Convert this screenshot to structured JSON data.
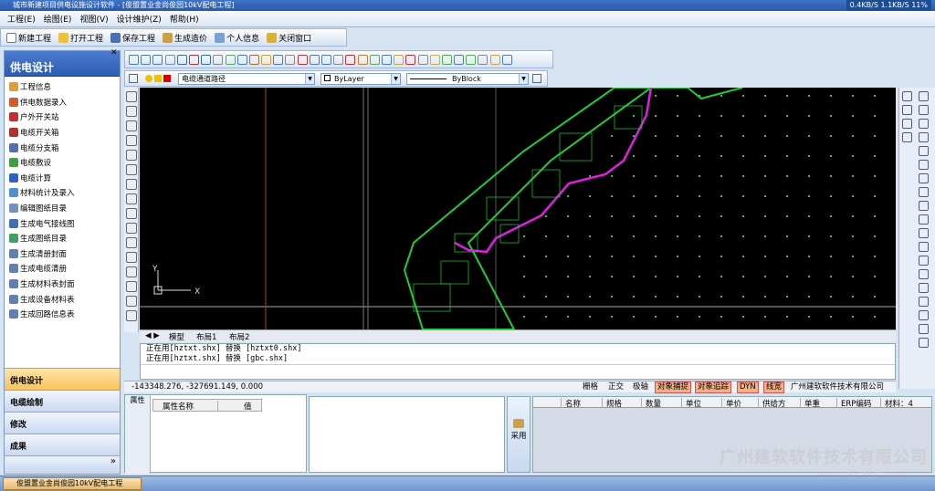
{
  "window": {
    "title": "城市新建项目供电设施设计软件 - [俊盟置业金尚俊园10kV配电工程]",
    "net_status": "0.4KB/S  1.1KB/S  11%"
  },
  "menu": [
    "工程(E)",
    "绘图(E)",
    "视图(V)",
    "设计维护(Z)",
    "帮助(H)"
  ],
  "toolbar": [
    "新建工程",
    "打开工程",
    "保存工程",
    "生成造价",
    "个人信息",
    "关闭窗口"
  ],
  "sidebar": {
    "title": "供电设计",
    "items": [
      "工程信息",
      "供电数据录入",
      "户外开关站",
      "电缆开关箱",
      "电缆分支箱",
      "电缆敷设",
      "电缆计算",
      "材料统计及录入",
      "编辑图纸目录",
      "生成电气接线图",
      "生成图纸目录",
      "生成清册封面",
      "生成电缆清册",
      "生成材料表封面",
      "生成设备材料表",
      "生成回路信息表"
    ],
    "nav": [
      "供电设计",
      "电缆绘制",
      "修改",
      "成果"
    ],
    "nav_active": "供电设计"
  },
  "layerbar": {
    "layer": "电缆通道路径",
    "color": "ByLayer",
    "linetype": "ByBlock"
  },
  "tabs": [
    "模型",
    "布局1",
    "布局2"
  ],
  "command": [
    "正在用[hztxt.shx] 替换 [hztxt0.shx]",
    "正在用[hztxt.shx] 替换 [gbc.shx]"
  ],
  "status": {
    "coords": "-143348.276,  -327691.149,  0.000",
    "toggles": [
      {
        "label": "栅格",
        "on": false
      },
      {
        "label": "正交",
        "on": false
      },
      {
        "label": "极轴",
        "on": false
      },
      {
        "label": "对象捕捉",
        "on": true
      },
      {
        "label": "对象追踪",
        "on": true
      },
      {
        "label": "DYN",
        "on": true
      },
      {
        "label": "线宽",
        "on": true
      }
    ],
    "company": "广州建软软件技术有限公司"
  },
  "properties": {
    "col1": "属性名称",
    "col2": "值",
    "side_label": "属性"
  },
  "pick_button": "采用",
  "materials": {
    "headers": [
      "名称",
      "规格",
      "数量",
      "单位",
      "单价",
      "供给方",
      "单重",
      "ERP编码",
      "材料：4"
    ]
  },
  "taskbar": {
    "item": "俊盟置业金尚俊园10kV配电工程"
  },
  "watermark": {
    "line1": "广州建软软件技术有限公司",
    "line2": "www.hc360.com"
  },
  "colors": {
    "cad_bg": "#000000",
    "walls": "#22cc33",
    "cable_path": "#e020e0",
    "accent": "#2e5db5"
  }
}
